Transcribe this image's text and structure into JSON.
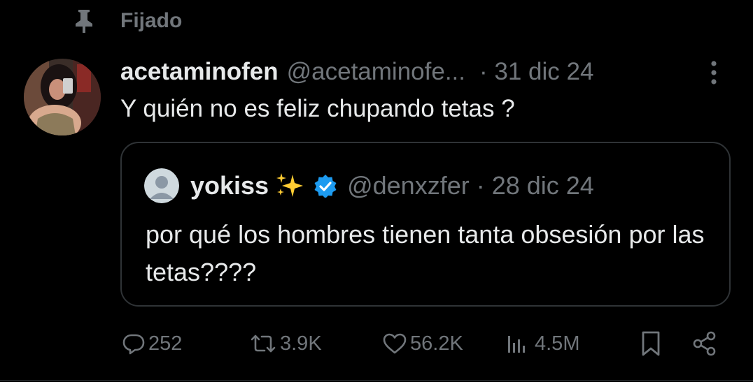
{
  "pinned": {
    "label": "Fijado",
    "icon": "pin-icon"
  },
  "tweet": {
    "display_name": "acetaminofen",
    "handle": "@acetaminofe...",
    "date": "· 31 dic 24",
    "text": "Y quién no es feliz chupando tetas ?",
    "more_icon": "more-vertical-icon"
  },
  "quote": {
    "display_name": "yokiss",
    "emoji": "sparkles-icon",
    "verified_icon": "verified-badge-icon",
    "handle_date": "@denxzfer · 28 dic 24",
    "text": "por qué los hombres tienen tanta obsesión por las tetas????"
  },
  "actions": {
    "reply_count": "252",
    "repost_count": "3.9K",
    "like_count": "56.2K",
    "view_count": "4.5M"
  },
  "colors": {
    "background": "#000000",
    "text_primary": "#e7e9ea",
    "text_secondary": "#71767b",
    "border": "#2f3336",
    "verified_blue": "#1d9bf0"
  }
}
